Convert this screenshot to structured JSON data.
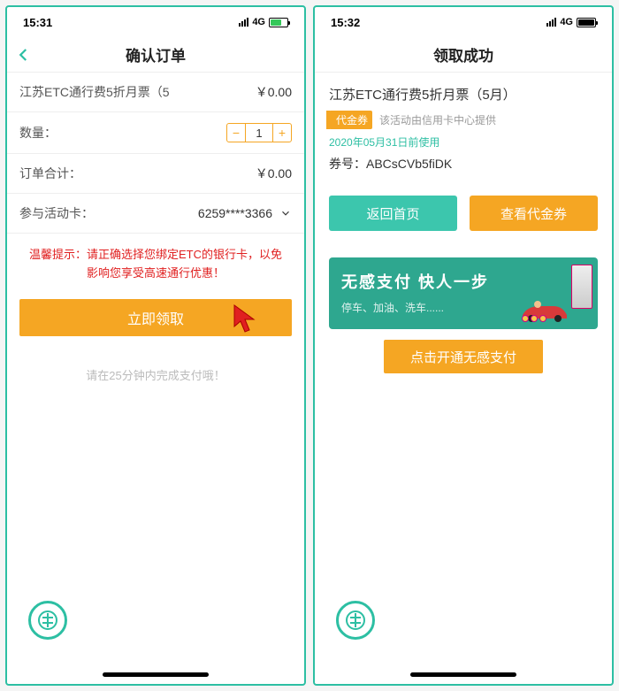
{
  "left": {
    "status": {
      "time": "15:31",
      "net": "4G"
    },
    "nav_title": "确认订单",
    "product_name": "江苏ETC通行费5折月票（5",
    "product_price": "￥0.00",
    "qty_label": "数量：",
    "qty_value": "1",
    "total_label": "订单合计：",
    "total_value": "￥0.00",
    "card_label": "参与活动卡：",
    "card_value": "6259****3366",
    "tip_prefix": "温馨提示：",
    "tip_text": "请正确选择您绑定ETC的银行卡，以免影响您享受高速通行优惠！",
    "primary_btn": "立即领取",
    "hint": "请在25分钟内完成支付哦！"
  },
  "right": {
    "status": {
      "time": "15:32",
      "net": "4G"
    },
    "nav_title": "领取成功",
    "product_name": "江苏ETC通行费5折月票（5月）",
    "voucher_tag": "代金券",
    "voucher_sub": "该活动由信用卡中心提供",
    "expire": "2020年05月31日前使用",
    "coupon_label": "券号：",
    "coupon_no": "ABCsCVb5fiDK",
    "btn_home": "返回首页",
    "btn_view": "查看代金券",
    "promo_title": "无感支付 快人一步",
    "promo_sub": "停车、加油、洗车......",
    "secondary_btn": "点击开通无感支付"
  }
}
